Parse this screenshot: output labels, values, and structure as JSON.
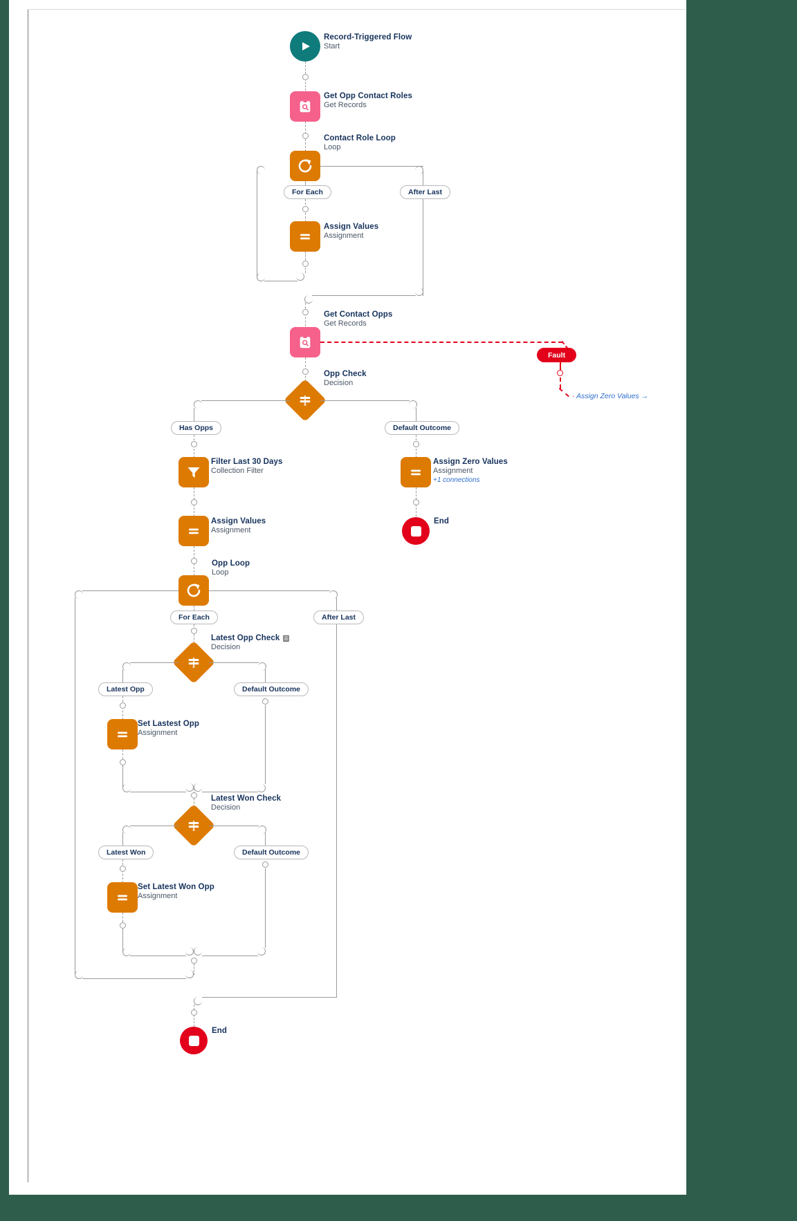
{
  "diagram": {
    "title": "Record-Triggered Flow",
    "colors": {
      "start": "#0f7b7b",
      "get_records": "#f5618b",
      "element_orange": "#dd7a01",
      "end": "#e2001a",
      "fault": "#e2001a",
      "connector": "#9a9a9a",
      "link_text": "#2d6ecf"
    },
    "nodes": [
      {
        "id": "start",
        "name": "Record-Triggered Flow",
        "type": "Start",
        "icon": "play-icon"
      },
      {
        "id": "get_opp_roles",
        "name": "Get Opp Contact Roles",
        "type": "Get Records",
        "icon": "get-records-icon"
      },
      {
        "id": "contact_role_loop",
        "name": "Contact Role Loop",
        "type": "Loop",
        "icon": "loop-icon"
      },
      {
        "id": "assign_values_1",
        "name": "Assign Values",
        "type": "Assignment",
        "icon": "assignment-icon"
      },
      {
        "id": "get_contact_opps",
        "name": "Get Contact Opps",
        "type": "Get Records",
        "icon": "get-records-icon"
      },
      {
        "id": "opp_check",
        "name": "Opp Check",
        "type": "Decision",
        "icon": "decision-icon"
      },
      {
        "id": "filter_30_days",
        "name": "Filter Last 30 Days",
        "type": "Collection Filter",
        "icon": "filter-icon"
      },
      {
        "id": "assign_values_2",
        "name": "Assign Values",
        "type": "Assignment",
        "icon": "assignment-icon"
      },
      {
        "id": "assign_zero",
        "name": "Assign Zero Values",
        "type": "Assignment",
        "icon": "assignment-icon",
        "extra": "+1 connections"
      },
      {
        "id": "end_1",
        "name": "End",
        "type": "",
        "icon": "end-icon"
      },
      {
        "id": "opp_loop",
        "name": "Opp Loop",
        "type": "Loop",
        "icon": "loop-icon"
      },
      {
        "id": "latest_opp_check",
        "name": "Latest Opp Check",
        "type": "Decision",
        "icon": "decision-icon",
        "has_note": true
      },
      {
        "id": "set_lastest_opp",
        "name": "Set Lastest Opp",
        "type": "Assignment",
        "icon": "assignment-icon"
      },
      {
        "id": "latest_won_check",
        "name": "Latest Won Check",
        "type": "Decision",
        "icon": "decision-icon"
      },
      {
        "id": "set_latest_won",
        "name": "Set Latest Won Opp",
        "type": "Assignment",
        "icon": "assignment-icon"
      },
      {
        "id": "end_2",
        "name": "End",
        "type": "",
        "icon": "end-icon"
      }
    ],
    "branch_labels": {
      "loop1_for_each": "For Each",
      "loop1_after_last": "After Last",
      "opp_check_has_opps": "Has Opps",
      "opp_check_default": "Default Outcome",
      "loop2_for_each": "For Each",
      "loop2_after_last": "After Last",
      "latest_opp": "Latest Opp",
      "latest_opp_default": "Default Outcome",
      "latest_won": "Latest Won",
      "latest_won_default": "Default Outcome"
    },
    "fault": {
      "label": "Fault",
      "goto_target": "Assign Zero Values →"
    }
  }
}
